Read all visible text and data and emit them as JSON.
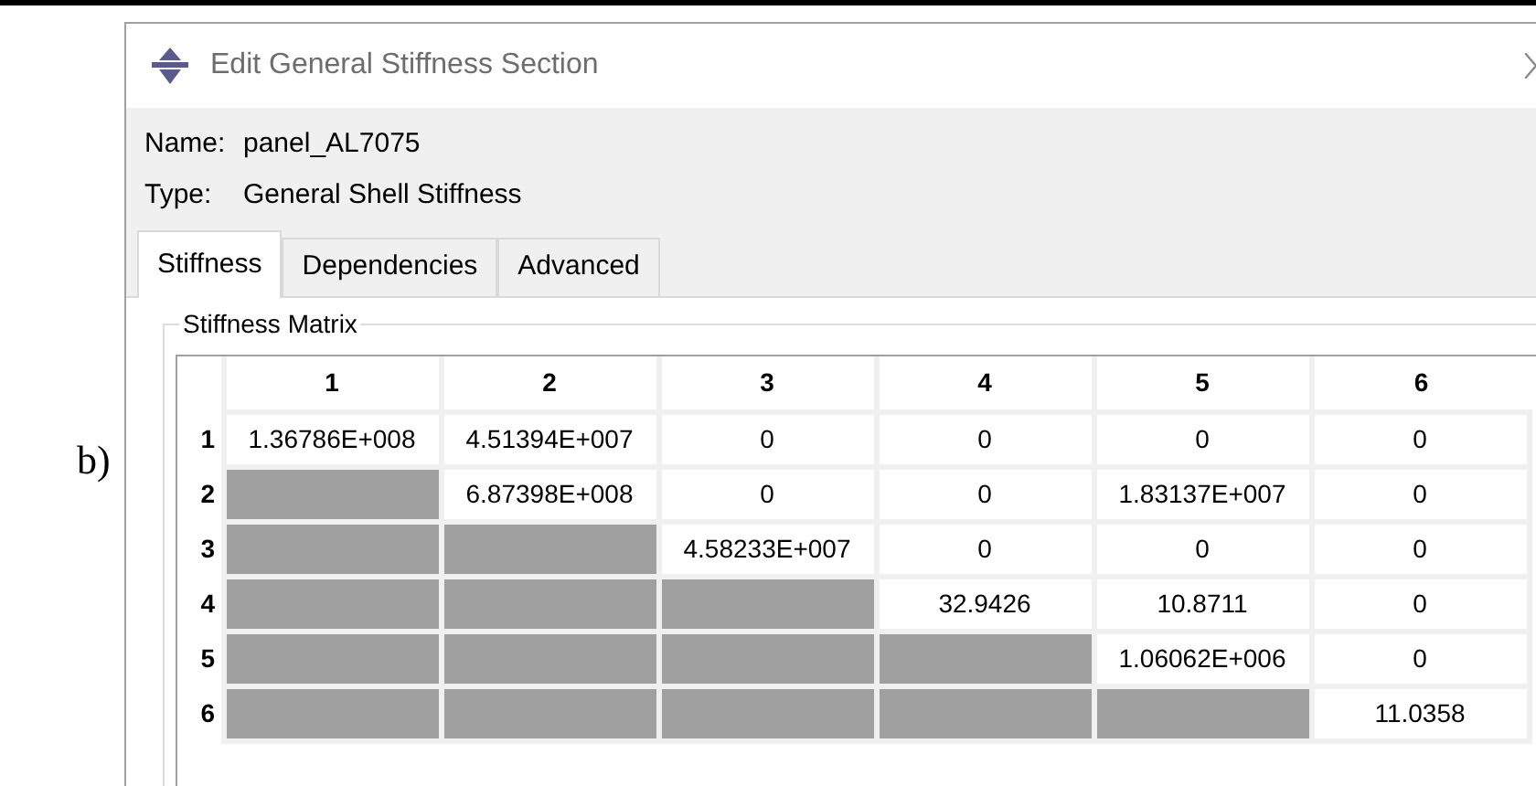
{
  "figure_label": "b)",
  "window": {
    "title": "Edit General Stiffness Section"
  },
  "fields": [
    {
      "label": "Name:",
      "value": "panel_AL7075"
    },
    {
      "label": "Type:",
      "value": "General Shell Stiffness"
    }
  ],
  "tabs": [
    {
      "label": "Stiffness",
      "selected": true
    },
    {
      "label": "Dependencies",
      "selected": false
    },
    {
      "label": "Advanced",
      "selected": false
    }
  ],
  "group": {
    "title": "Stiffness Matrix"
  },
  "table": {
    "columns": [
      "1",
      "2",
      "3",
      "4",
      "5",
      "6"
    ],
    "rows": [
      {
        "header": "1",
        "cells": [
          {
            "text": "1.36786E+008",
            "disabled": false
          },
          {
            "text": "4.51394E+007",
            "disabled": false
          },
          {
            "text": "0",
            "disabled": false
          },
          {
            "text": "0",
            "disabled": false
          },
          {
            "text": "0",
            "disabled": false
          },
          {
            "text": "0",
            "disabled": false
          }
        ]
      },
      {
        "header": "2",
        "cells": [
          {
            "disabled": true
          },
          {
            "text": "6.87398E+008",
            "disabled": false
          },
          {
            "text": "0",
            "disabled": false
          },
          {
            "text": "0",
            "disabled": false
          },
          {
            "text": "1.83137E+007",
            "disabled": false
          },
          {
            "text": "0",
            "disabled": false
          }
        ]
      },
      {
        "header": "3",
        "cells": [
          {
            "disabled": true
          },
          {
            "disabled": true
          },
          {
            "text": "4.58233E+007",
            "disabled": false
          },
          {
            "text": "0",
            "disabled": false
          },
          {
            "text": "0",
            "disabled": false
          },
          {
            "text": "0",
            "disabled": false
          }
        ]
      },
      {
        "header": "4",
        "cells": [
          {
            "disabled": true
          },
          {
            "disabled": true
          },
          {
            "disabled": true
          },
          {
            "text": "32.9426",
            "disabled": false
          },
          {
            "text": "10.8711",
            "disabled": false
          },
          {
            "text": "0",
            "disabled": false
          }
        ]
      },
      {
        "header": "5",
        "cells": [
          {
            "disabled": true
          },
          {
            "disabled": true
          },
          {
            "disabled": true
          },
          {
            "disabled": true
          },
          {
            "text": "1.06062E+006",
            "disabled": false
          },
          {
            "text": "0",
            "disabled": false
          }
        ]
      },
      {
        "header": "6",
        "cells": [
          {
            "disabled": true
          },
          {
            "disabled": true
          },
          {
            "disabled": true
          },
          {
            "disabled": true
          },
          {
            "disabled": true
          },
          {
            "text": "11.0358",
            "disabled": false
          }
        ]
      }
    ]
  }
}
